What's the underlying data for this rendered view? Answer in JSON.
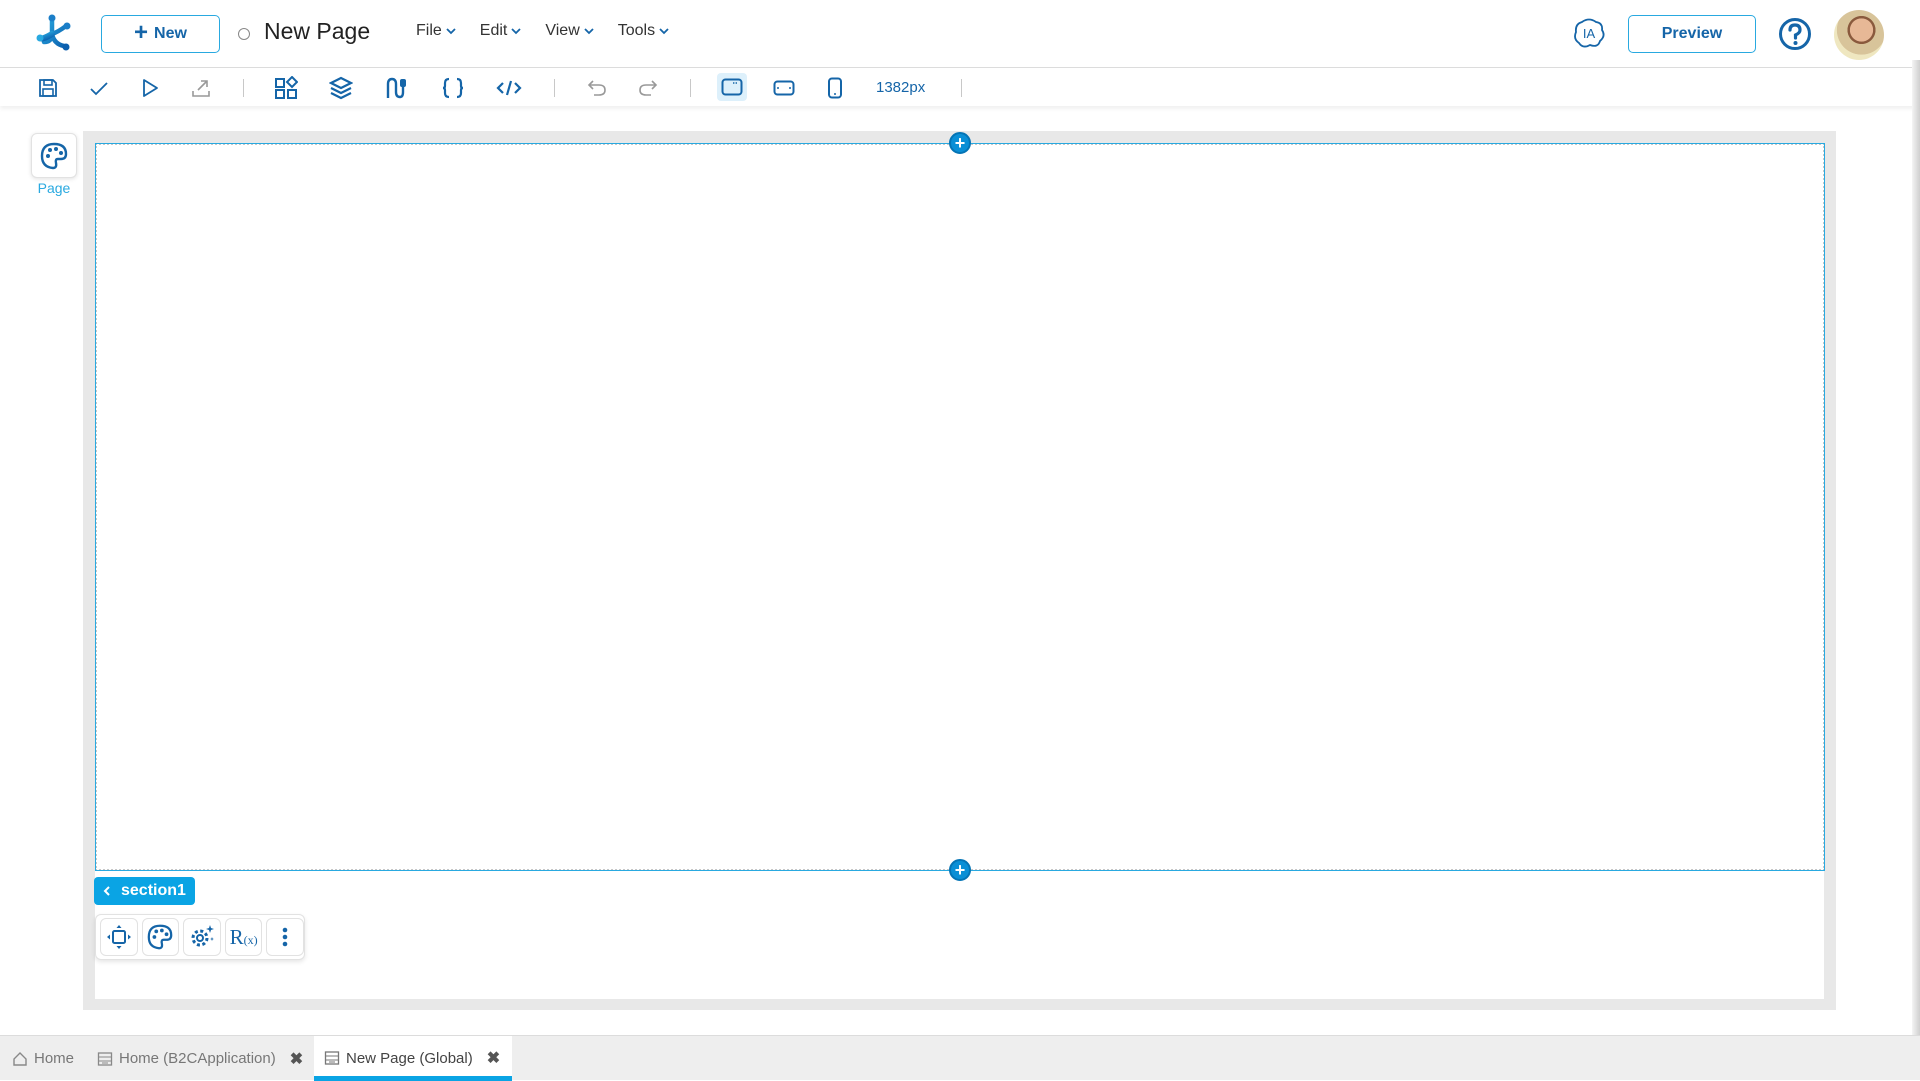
{
  "header": {
    "logo": "app-logo",
    "new_button": "New",
    "page_title": "New Page",
    "menus": [
      {
        "label": "File"
      },
      {
        "label": "Edit"
      },
      {
        "label": "View"
      },
      {
        "label": "Tools"
      }
    ],
    "ia_label": "IA",
    "preview_button": "Preview",
    "help_icon": "question-circle-icon",
    "avatar": "user-avatar"
  },
  "toolbar": {
    "icons": [
      "save-icon",
      "check-icon",
      "play-icon",
      "export-icon",
      "widgets-icon",
      "layers-icon",
      "flows-icon",
      "braces-icon",
      "code-icon",
      "undo-icon",
      "redo-icon",
      "desktop-icon",
      "tablet-icon",
      "mobile-icon"
    ],
    "width_value": "1382px",
    "active_device": "desktop"
  },
  "side_panel": {
    "page_label": "Page"
  },
  "canvas": {
    "section_name": "section1",
    "actions": [
      "move-icon",
      "palette-icon",
      "settings-ai-icon",
      "rules-icon",
      "more-icon"
    ],
    "rules_label": "R",
    "rules_sub": "(x)"
  },
  "tabs": [
    {
      "label": "Home",
      "icon": "home-icon",
      "closable": false,
      "active": false
    },
    {
      "label": "Home (B2CApplication)",
      "icon": "page-icon",
      "closable": true,
      "active": false
    },
    {
      "label": "New Page (Global)",
      "icon": "page-icon",
      "closable": true,
      "active": true
    }
  ],
  "colors": {
    "accent": "#1565a8",
    "highlight": "#0aa4e4",
    "border_accent": "#29a9e0"
  }
}
